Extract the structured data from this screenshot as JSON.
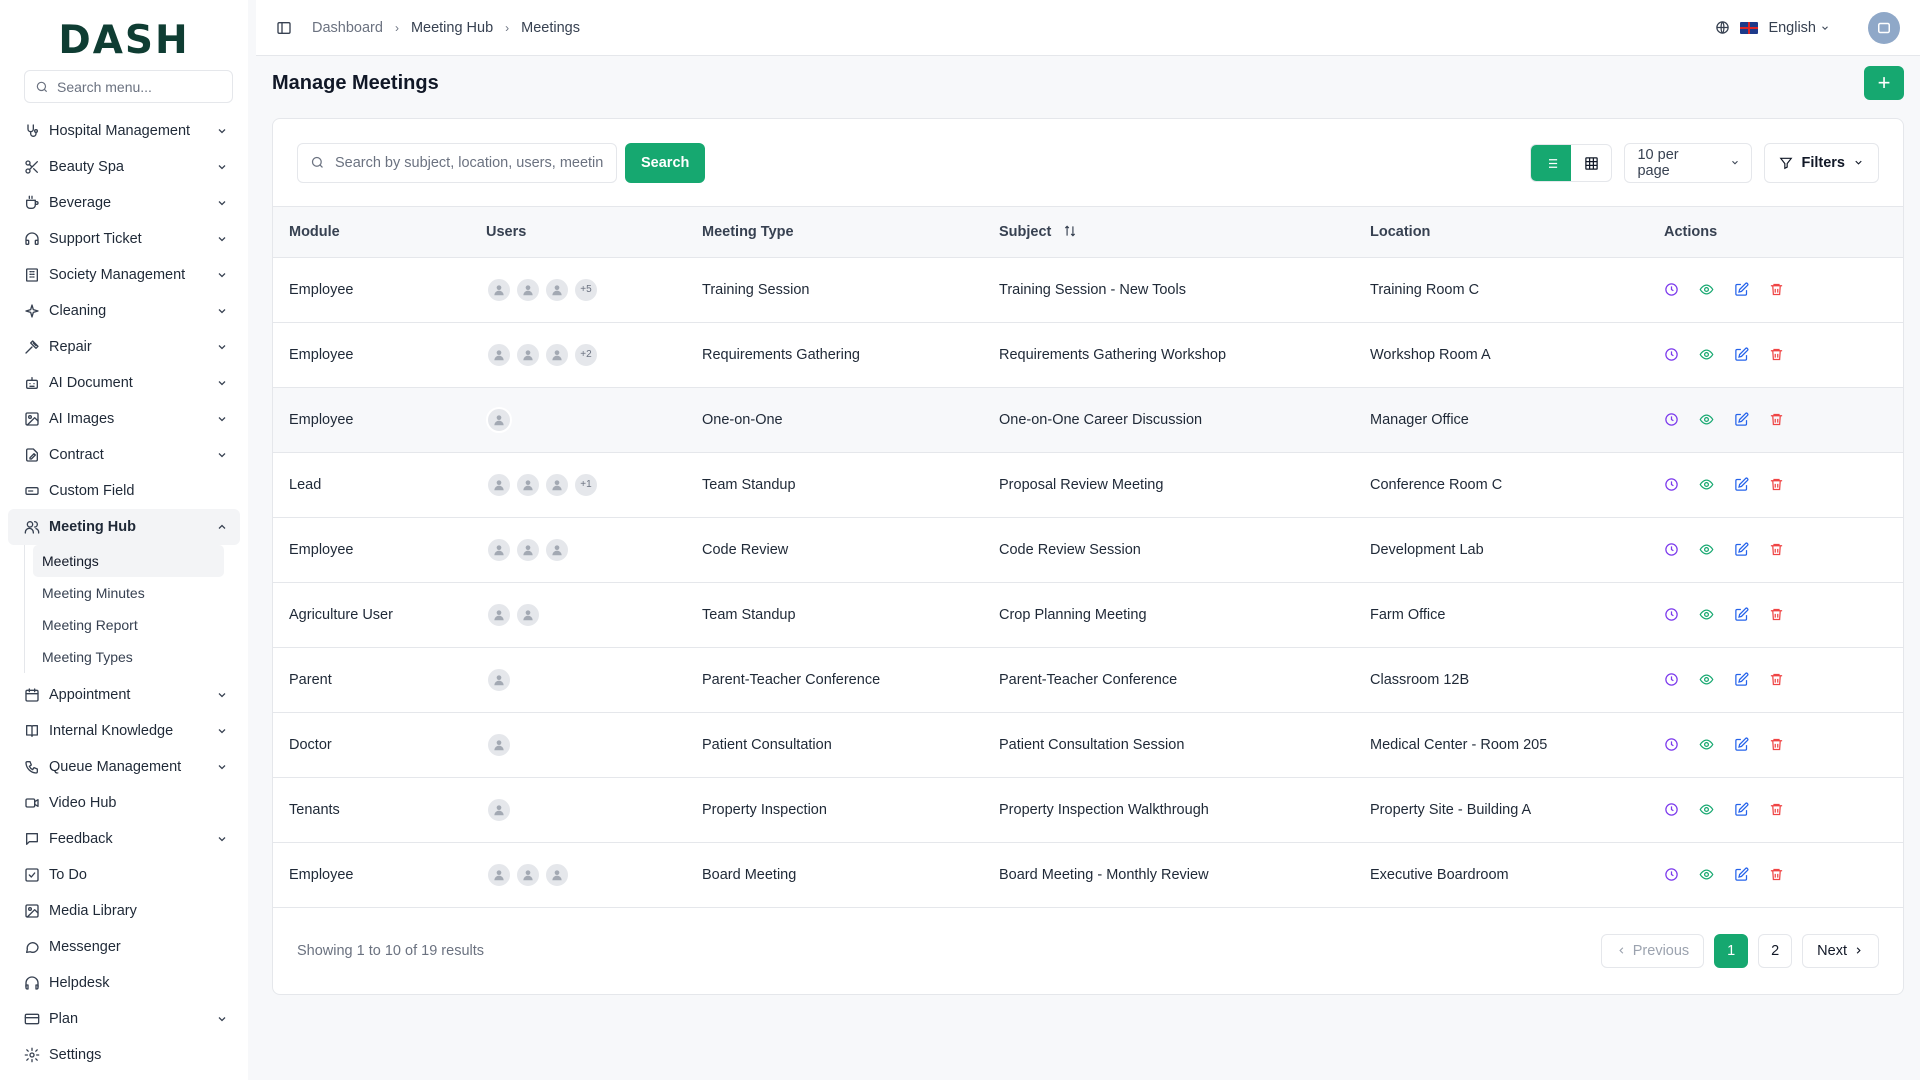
{
  "sidebar": {
    "logo": "DASH",
    "search_placeholder": "Search menu...",
    "items": [
      {
        "label": "Hospital Management",
        "icon": "stethoscope-icon",
        "chevron": true
      },
      {
        "label": "Beauty Spa",
        "icon": "scissors-icon",
        "chevron": true
      },
      {
        "label": "Beverage",
        "icon": "cup-icon",
        "chevron": true
      },
      {
        "label": "Support Ticket",
        "icon": "headset-icon",
        "chevron": true
      },
      {
        "label": "Society Management",
        "icon": "building-icon",
        "chevron": true
      },
      {
        "label": "Cleaning",
        "icon": "sparkle-icon",
        "chevron": true
      },
      {
        "label": "Repair",
        "icon": "hammer-icon",
        "chevron": true
      },
      {
        "label": "AI Document",
        "icon": "robot-icon",
        "chevron": true
      },
      {
        "label": "AI Images",
        "icon": "image-icon",
        "chevron": true
      },
      {
        "label": "Contract",
        "icon": "file-signature-icon",
        "chevron": true
      },
      {
        "label": "Custom Field",
        "icon": "form-field-icon",
        "chevron": false
      },
      {
        "label": "Meeting Hub",
        "icon": "users-icon",
        "chevron": true,
        "open": true
      }
    ],
    "submenu": [
      "Meetings",
      "Meeting Minutes",
      "Meeting Report",
      "Meeting Types"
    ],
    "items_after": [
      {
        "label": "Appointment",
        "icon": "calendar-icon",
        "chevron": true
      },
      {
        "label": "Internal Knowledge",
        "icon": "book-icon",
        "chevron": true
      },
      {
        "label": "Queue Management",
        "icon": "phone-icon",
        "chevron": true
      },
      {
        "label": "Video Hub",
        "icon": "video-icon",
        "chevron": false
      },
      {
        "label": "Feedback",
        "icon": "message-icon",
        "chevron": true
      },
      {
        "label": "To Do",
        "icon": "checkbox-icon",
        "chevron": false
      },
      {
        "label": "Media Library",
        "icon": "media-icon",
        "chevron": false
      },
      {
        "label": "Messenger",
        "icon": "chat-icon",
        "chevron": false
      },
      {
        "label": "Helpdesk",
        "icon": "headphones-icon",
        "chevron": false
      },
      {
        "label": "Plan",
        "icon": "card-icon",
        "chevron": true
      },
      {
        "label": "Settings",
        "icon": "gear-icon",
        "chevron": false
      }
    ]
  },
  "topbar": {
    "breadcrumbs": [
      "Dashboard",
      "Meeting Hub",
      "Meetings"
    ],
    "language": "English"
  },
  "page": {
    "title": "Manage Meetings",
    "add_label": "+"
  },
  "toolbar": {
    "search_placeholder": "Search by subject, location, users, meeting type...",
    "search_button": "Search",
    "per_page": "10 per page",
    "filters": "Filters"
  },
  "table": {
    "headers": [
      "Module",
      "Users",
      "Meeting Type",
      "Subject",
      "Location",
      "Actions"
    ],
    "rows": [
      {
        "module": "Employee",
        "avatars": 3,
        "more": "+5",
        "type": "Training Session",
        "subject": "Training Session - New Tools",
        "location": "Training Room C"
      },
      {
        "module": "Employee",
        "avatars": 3,
        "more": "+2",
        "type": "Requirements Gathering",
        "subject": "Requirements Gathering Workshop",
        "location": "Workshop Room A"
      },
      {
        "module": "Employee",
        "avatars": 1,
        "more": "",
        "type": "One-on-One",
        "subject": "One-on-One Career Discussion",
        "location": "Manager Office"
      },
      {
        "module": "Lead",
        "avatars": 3,
        "more": "+1",
        "type": "Team Standup",
        "subject": "Proposal Review Meeting",
        "location": "Conference Room C"
      },
      {
        "module": "Employee",
        "avatars": 3,
        "more": "",
        "type": "Code Review",
        "subject": "Code Review Session",
        "location": "Development Lab"
      },
      {
        "module": "Agriculture User",
        "avatars": 2,
        "more": "",
        "type": "Team Standup",
        "subject": "Crop Planning Meeting",
        "location": "Farm Office"
      },
      {
        "module": "Parent",
        "avatars": 1,
        "more": "",
        "type": "Parent-Teacher Conference",
        "subject": "Parent-Teacher Conference",
        "location": "Classroom 12B"
      },
      {
        "module": "Doctor",
        "avatars": 1,
        "more": "",
        "type": "Patient Consultation",
        "subject": "Patient Consultation Session",
        "location": "Medical Center - Room 205"
      },
      {
        "module": "Tenants",
        "avatars": 1,
        "more": "",
        "type": "Property Inspection",
        "subject": "Property Inspection Walkthrough",
        "location": "Property Site - Building A"
      },
      {
        "module": "Employee",
        "avatars": 3,
        "more": "",
        "type": "Board Meeting",
        "subject": "Board Meeting - Monthly Review",
        "location": "Executive Boardroom"
      }
    ]
  },
  "footer": {
    "showing": "Showing 1 to 10 of 19 results",
    "previous": "Previous",
    "next": "Next",
    "pages": [
      "1",
      "2"
    ],
    "current_page": "1"
  },
  "colors": {
    "accent": "#16a870",
    "history": "#7c3aed",
    "view": "#16a870",
    "edit": "#2563eb",
    "delete": "#ef4444"
  }
}
